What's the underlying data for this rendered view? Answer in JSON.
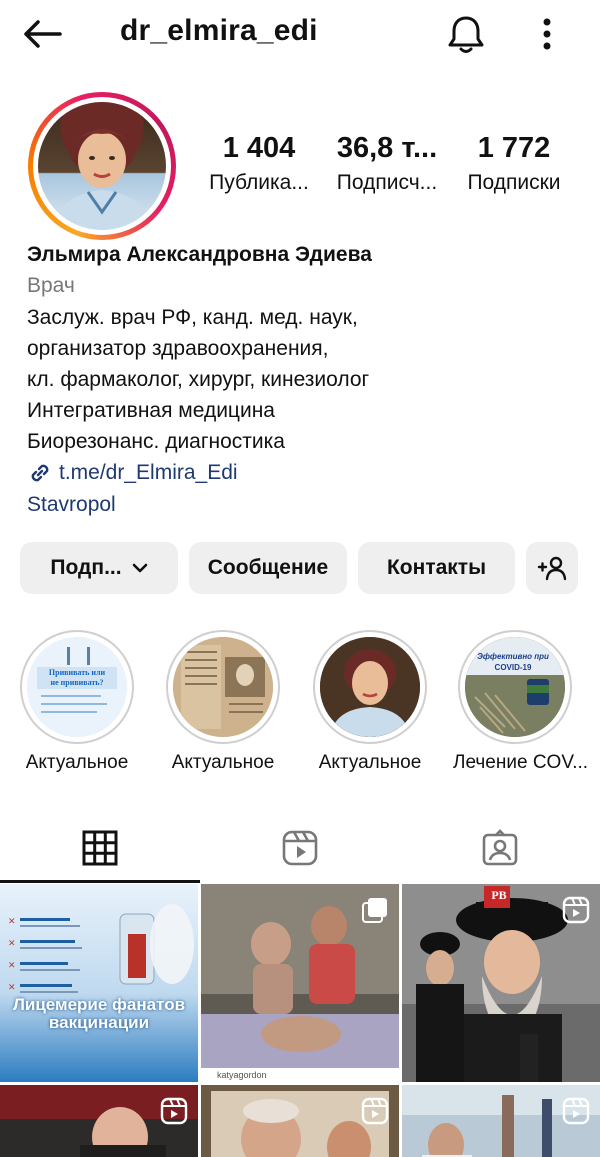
{
  "header": {
    "username": "dr_elmira_edi"
  },
  "stats": [
    {
      "value": "1 404",
      "label": "Публика..."
    },
    {
      "value": "36,8 т...",
      "label": "Подписч..."
    },
    {
      "value": "1 772",
      "label": "Подписки"
    }
  ],
  "bio": {
    "name": "Эльмира Александровна Эдиева",
    "category": "Врач",
    "lines": [
      "Заслуж.  врач  РФ, канд.  мед. наук,",
      "организатор здравоохранения,",
      "кл. фармаколог, хирург, кинезиолог",
      "Интегративная медицина",
      "Биорезонанс. диагностика"
    ],
    "link": "t.me/dr_Elmira_Edi",
    "location": "Stavropol"
  },
  "buttons": {
    "follow": "Подп...",
    "message": "Сообщение",
    "contacts": "Контакты"
  },
  "highlights": [
    {
      "label": "Актуальное",
      "text_a": "Прививать или не прививать?"
    },
    {
      "label": "Актуальное"
    },
    {
      "label": "Актуальное"
    },
    {
      "label": "Лечение COV...",
      "text_a": "Эффективно при COVID-19"
    }
  ],
  "grid": {
    "post1_caption": "Лицемерие фанатов вакцинации",
    "post3_badge": "PB",
    "post2_credit": "katyagordon"
  },
  "colors": {
    "link": "#1e3a70",
    "button_bg": "#efefef",
    "ring_gradient": [
      "#f9a825",
      "#e91e63"
    ]
  }
}
